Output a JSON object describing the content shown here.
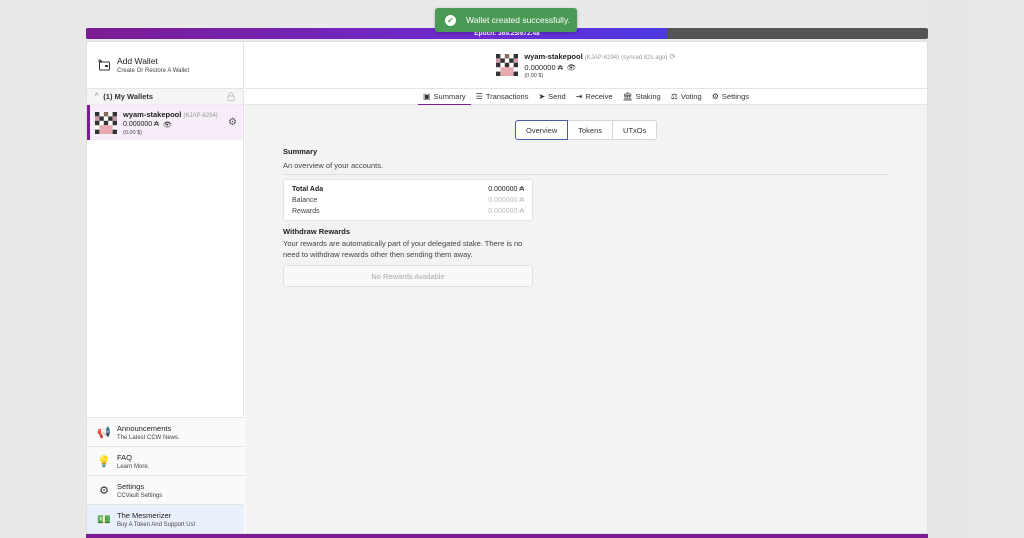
{
  "toast": {
    "message": "Wallet created successfully."
  },
  "epoch": {
    "text": "Epoch: 369.25/672.48",
    "progress": 0.69
  },
  "sidebar": {
    "add_wallet": {
      "title": "Add Wallet",
      "subtitle": "Create Or Restore A Wallet"
    },
    "my_wallets": {
      "label": "(1) My Wallets"
    },
    "wallets": [
      {
        "name": "wyam-stakepool",
        "id": "(KJAP-6294)",
        "balance": "0.000000 ₳",
        "usd": "(0.00 $)"
      }
    ],
    "bottom": [
      {
        "title": "Announcements",
        "subtitle": "The Latest CCW News.",
        "icon": "megaphone-icon"
      },
      {
        "title": "FAQ",
        "subtitle": "Learn More.",
        "icon": "lightbulb-icon"
      },
      {
        "title": "Settings",
        "subtitle": "CCVault Settings",
        "icon": "gear-icon"
      },
      {
        "title": "The Mesmerizer",
        "subtitle": "Buy A Token And Support Us!",
        "icon": "money-icon"
      }
    ]
  },
  "header": {
    "name": "wyam-stakepool",
    "id": "(KJAP-6294)",
    "synced": "(synced 82s ago)",
    "balance": "0.000000 ₳",
    "usd": "(0.00 $)"
  },
  "nav": {
    "items": [
      {
        "label": "Summary",
        "icon": "summary-icon",
        "active": true
      },
      {
        "label": "Transactions",
        "icon": "transactions-icon"
      },
      {
        "label": "Send",
        "icon": "send-icon"
      },
      {
        "label": "Receive",
        "icon": "receive-icon"
      },
      {
        "label": "Staking",
        "icon": "staking-icon"
      },
      {
        "label": "Voting",
        "icon": "voting-icon"
      },
      {
        "label": "Settings",
        "icon": "settings-icon"
      }
    ]
  },
  "tabs": {
    "items": [
      "Overview",
      "Tokens",
      "UTxOs"
    ],
    "active": "Overview"
  },
  "summary": {
    "title": "Summary",
    "description": "An overview of your accounts.",
    "rows": [
      {
        "label": "Total Ada",
        "value": "0.000000 ₳"
      },
      {
        "label": "Balance",
        "value": "0.000000 ₳"
      },
      {
        "label": "Rewards",
        "value": "0.000000 ₳"
      }
    ]
  },
  "withdraw": {
    "title": "Withdraw Rewards",
    "description": "Your rewards are automatically part of your delegated stake. There is no need to withdraw rewards other then sending them away.",
    "button": "No Rewards Available"
  },
  "colors": {
    "accent": "#7b1c92",
    "toast": "#4a9a55"
  }
}
